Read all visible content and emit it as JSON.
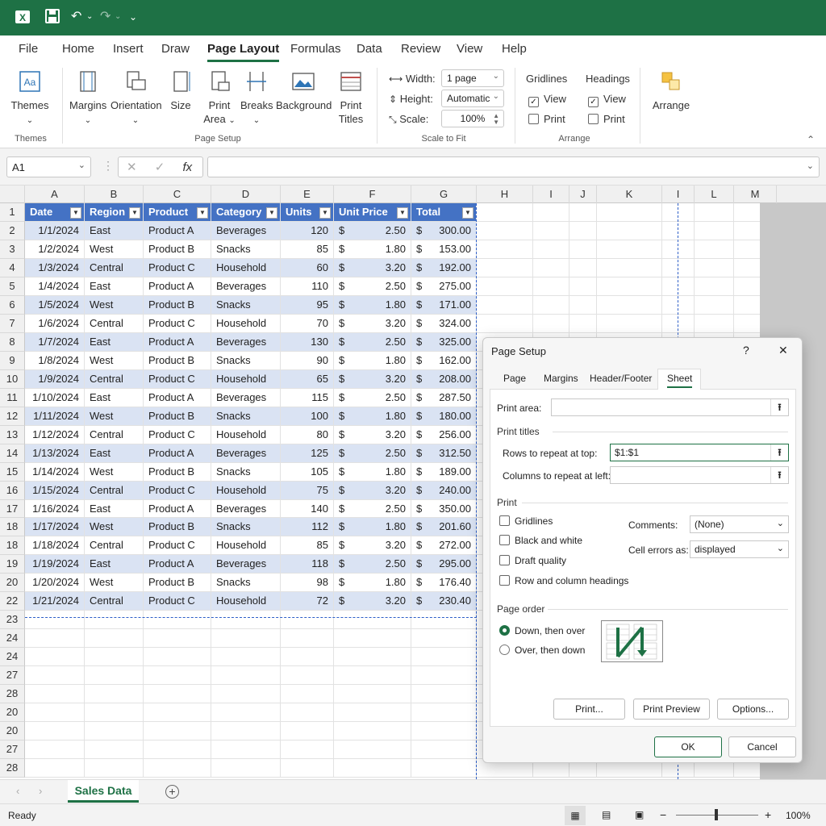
{
  "titlebar": {
    "app_icon": "excel-icon",
    "save": "save-icon",
    "undo": "undo-icon",
    "redo": "redo-icon",
    "qat": "customize-icon"
  },
  "tabs": [
    "File",
    "Home",
    "Insert",
    "Draw",
    "Page Layout",
    "Formulas",
    "Data",
    "Review",
    "View",
    "Help"
  ],
  "ribbon": {
    "themes": {
      "label": "Themes",
      "group": "Themes"
    },
    "page_setup": {
      "group": "Page Setup",
      "margins": "Margins",
      "orientation": "Orientation",
      "size": "Size",
      "print_area_1": "Print",
      "print_area_2": "Area",
      "breaks": "Breaks",
      "background": "Background",
      "print_titles_1": "Print",
      "print_titles_2": "Titles"
    },
    "scale": {
      "group": "Scale to Fit",
      "width_label": "Width:",
      "width_value": "1 page",
      "height_label": "Height:",
      "height_value": "Automatic",
      "scale_label": "Scale:",
      "scale_value": "100%"
    },
    "sheet_options": {
      "group": "Arrange",
      "gridlines": "Gridlines",
      "headings": "Headings",
      "view": "View",
      "print": "Print"
    },
    "arrange": {
      "label": "Arrange"
    }
  },
  "formula_bar": {
    "name_box": "A1",
    "cancel": "✕",
    "enter": "✓",
    "fx": "fx",
    "value": ""
  },
  "columns": [
    "A",
    "B",
    "C",
    "D",
    "E",
    "F",
    "G",
    "H",
    "I",
    "J",
    "K",
    "I",
    "L",
    "M"
  ],
  "row_numbers": [
    "1",
    "2",
    "3",
    "4",
    "5",
    "6",
    "7",
    "8",
    "9",
    "10",
    "11",
    "12",
    "13",
    "14",
    "15",
    "16",
    "17",
    "18",
    "18",
    "19",
    "20",
    "22",
    "23",
    "24",
    "24",
    "27",
    "28",
    "20",
    "20",
    "27",
    "28"
  ],
  "table": {
    "headers": [
      "Date",
      "Region",
      "Product",
      "Category",
      "Units",
      "Unit Price",
      "Total"
    ],
    "rows": [
      [
        "1/1/2024",
        "East",
        "Product A",
        "Beverages",
        "120",
        "$",
        "2.50",
        "$",
        "300.00"
      ],
      [
        "1/2/2024",
        "West",
        "Product B",
        "Snacks",
        "85",
        "$",
        "1.80",
        "$",
        "153.00"
      ],
      [
        "1/3/2024",
        "Central",
        "Product C",
        "Household",
        "60",
        "$",
        "3.20",
        "$",
        "192.00"
      ],
      [
        "1/4/2024",
        "East",
        "Product A",
        "Beverages",
        "110",
        "$",
        "2.50",
        "$",
        "275.00"
      ],
      [
        "1/5/2024",
        "West",
        "Product B",
        "Snacks",
        "95",
        "$",
        "1.80",
        "$",
        "171.00"
      ],
      [
        "1/6/2024",
        "Central",
        "Product C",
        "Household",
        "70",
        "$",
        "3.20",
        "$",
        "324.00"
      ],
      [
        "1/7/2024",
        "East",
        "Product A",
        "Beverages",
        "130",
        "$",
        "2.50",
        "$",
        "325.00"
      ],
      [
        "1/8/2024",
        "West",
        "Product B",
        "Snacks",
        "90",
        "$",
        "1.80",
        "$",
        "162.00"
      ],
      [
        "1/9/2024",
        "Central",
        "Product C",
        "Household",
        "65",
        "$",
        "3.20",
        "$",
        "208.00"
      ],
      [
        "1/10/2024",
        "East",
        "Product A",
        "Beverages",
        "115",
        "$",
        "2.50",
        "$",
        "287.50"
      ],
      [
        "1/11/2024",
        "West",
        "Product B",
        "Snacks",
        "100",
        "$",
        "1.80",
        "$",
        "180.00"
      ],
      [
        "1/12/2024",
        "Central",
        "Product C",
        "Household",
        "80",
        "$",
        "3.20",
        "$",
        "256.00"
      ],
      [
        "1/13/2024",
        "East",
        "Product A",
        "Beverages",
        "125",
        "$",
        "2.50",
        "$",
        "312.50"
      ],
      [
        "1/14/2024",
        "West",
        "Product B",
        "Snacks",
        "105",
        "$",
        "1.80",
        "$",
        "189.00"
      ],
      [
        "1/15/2024",
        "Central",
        "Product C",
        "Household",
        "75",
        "$",
        "3.20",
        "$",
        "240.00"
      ],
      [
        "1/16/2024",
        "East",
        "Product A",
        "Beverages",
        "140",
        "$",
        "2.50",
        "$",
        "350.00"
      ],
      [
        "1/17/2024",
        "West",
        "Product B",
        "Snacks",
        "112",
        "$",
        "1.80",
        "$",
        "201.60"
      ],
      [
        "1/18/2024",
        "Central",
        "Product C",
        "Household",
        "85",
        "$",
        "3.20",
        "$",
        "272.00"
      ],
      [
        "1/19/2024",
        "East",
        "Product A",
        "Beverages",
        "118",
        "$",
        "2.50",
        "$",
        "295.00"
      ],
      [
        "1/20/2024",
        "West",
        "Product B",
        "Snacks",
        "98",
        "$",
        "1.80",
        "$",
        "176.40"
      ],
      [
        "1/21/2024",
        "Central",
        "Product C",
        "Household",
        "72",
        "$",
        "3.20",
        "$",
        "230.40"
      ]
    ]
  },
  "sheet_tabs": {
    "active": "Sales Data",
    "add": "+"
  },
  "status": {
    "ready": "Ready",
    "zoom": "100%"
  },
  "dialog": {
    "title": "Page Setup",
    "help": "?",
    "close": "✕",
    "tabs": [
      "Page",
      "Margins",
      "Header/Footer",
      "Sheet"
    ],
    "print_area": "Print area:",
    "print_titles": "Print titles",
    "rows_repeat": "Rows to repeat at top:",
    "rows_repeat_value": "$1:$1",
    "cols_repeat": "Columns to repeat at left:",
    "print_section": "Print",
    "gridlines": "Gridlines",
    "black_white": "Black and white",
    "draft": "Draft quality",
    "row_col_headings": "Row and column headings",
    "comments_label": "Comments:",
    "comments_value": "(None)",
    "cell_errors_label": "Cell errors as:",
    "cell_errors_value": "displayed",
    "page_order": "Page order",
    "down_over": "Down, then over",
    "over_down": "Over, then down",
    "print_btn": "Print...",
    "preview_btn": "Print Preview",
    "options_btn": "Options...",
    "ok": "OK",
    "cancel": "Cancel"
  }
}
